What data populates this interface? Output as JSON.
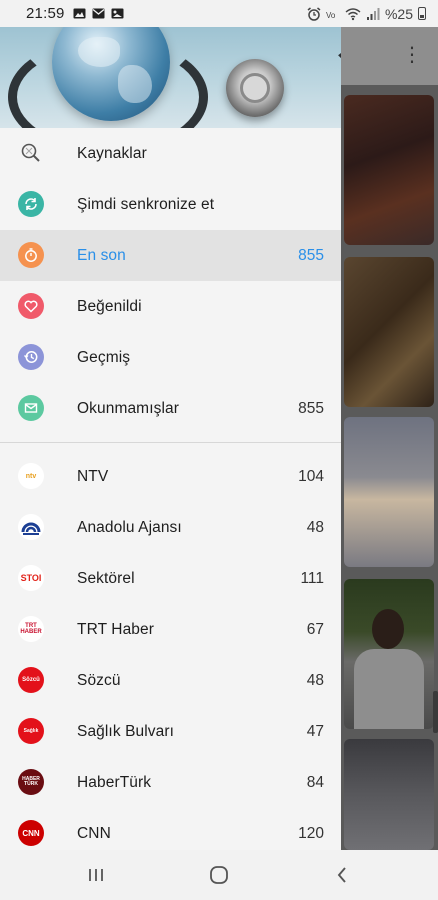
{
  "status_bar": {
    "time": "21:59",
    "battery_text": "%25"
  },
  "menu": {
    "sources_label": "Kaynaklar",
    "sync_label": "Şimdi senkronize et",
    "items": [
      {
        "label": "En son",
        "count": "855",
        "icon": "timer-icon",
        "color": "#f5924f",
        "active": true
      },
      {
        "label": "Beğenildi",
        "count": "",
        "icon": "heart-icon",
        "color": "#f05a6a"
      },
      {
        "label": "Geçmiş",
        "count": "",
        "icon": "history-icon",
        "color": "#8c94d8"
      },
      {
        "label": "Okunmamışlar",
        "count": "855",
        "icon": "envelope-icon",
        "color": "#5cc9a0"
      }
    ],
    "active_color": "#2a8fe8"
  },
  "sources": [
    {
      "label": "NTV",
      "count": "104",
      "logo_text": "ntv"
    },
    {
      "label": "Anadolu Ajansı",
      "count": "48",
      "logo_text": "AA"
    },
    {
      "label": "Sektörel",
      "count": "111",
      "logo_text": "STOI"
    },
    {
      "label": "TRT Haber",
      "count": "67",
      "logo_text": "TRT HABER"
    },
    {
      "label": "Sözcü",
      "count": "48",
      "logo_text": "Sözcü"
    },
    {
      "label": "Sağlık Bulvarı",
      "count": "47",
      "logo_text": "Sağlık"
    },
    {
      "label": "HaberTürk",
      "count": "84",
      "logo_text": "HABER TÜRK"
    },
    {
      "label": "CNN",
      "count": "120",
      "logo_text": "CNN"
    }
  ]
}
